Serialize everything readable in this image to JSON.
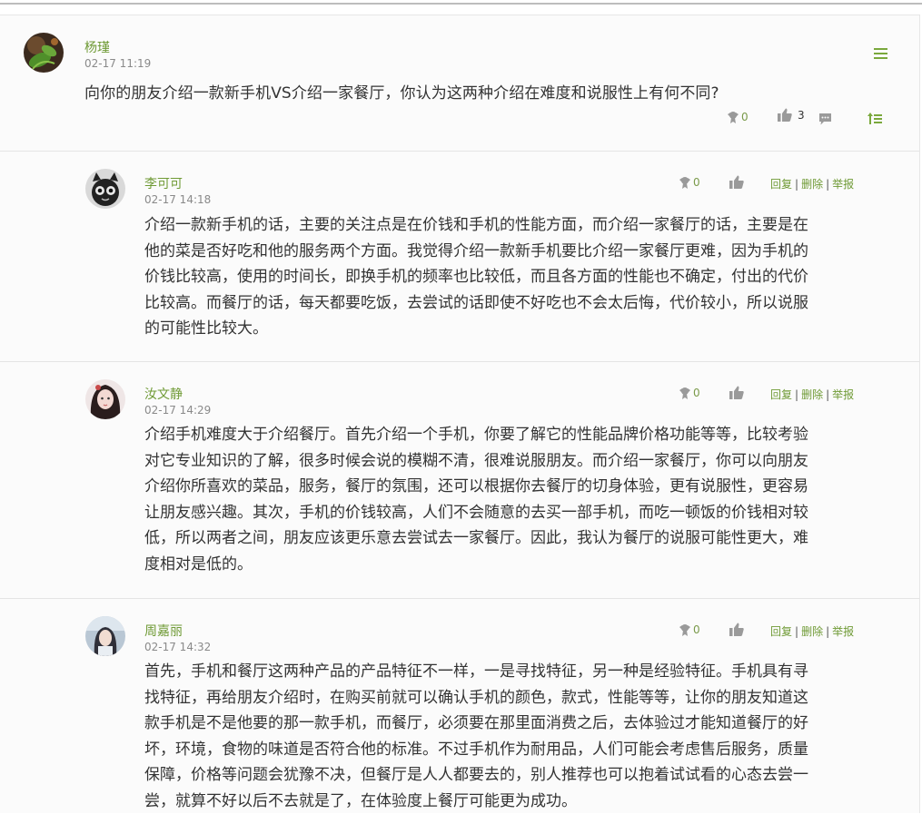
{
  "colors": {
    "accent": "#6f9a35",
    "icon": "#9a9a9a",
    "text": "#333333",
    "muted": "#8a8a8a"
  },
  "post": {
    "author": "杨瑾",
    "time": "02-17 11:19",
    "question": "向你的朋友介绍一款新手机VS介绍一家餐厅，你认为这两种介绍在难度和说服性上有何不同?",
    "badge_count": "0",
    "like_count": "3",
    "menu_icon": "menu-icon",
    "comment_icon": "comment-icon",
    "top_icon": "sort-up-icon"
  },
  "comment_actions": {
    "reply": "回复",
    "delete": "删除",
    "report": "举报",
    "separator": "|"
  },
  "comments": [
    {
      "author": "李可可",
      "time": "02-17 14:18",
      "badge_count": "0",
      "lines": [
        "介绍一款新手机的话，主要的关注点是在价钱和手机的性能方面，而介绍一家餐厅的话，主要是在",
        "他的菜是否好吃和他的服务两个方面。我觉得介绍一款新手机要比介绍一家餐厅更难，因为手机的",
        "价钱比较高，使用的时间长，即换手机的频率也比较低，而且各方面的性能也不确定，付出的代价",
        "比较高。而餐厅的话，每天都要吃饭，去尝试的话即使不好吃也不会太后悔，代价较小，所以说服",
        "的可能性比较大。"
      ]
    },
    {
      "author": "汝文静",
      "time": "02-17 14:29",
      "badge_count": "0",
      "lines": [
        "介绍手机难度大于介绍餐厅。首先介绍一个手机，你要了解它的性能品牌价格功能等等，比较考验",
        "对它专业知识的了解，很多时候会说的模糊不清，很难说服朋友。而介绍一家餐厅，你可以向朋友",
        "介绍你所喜欢的菜品，服务，餐厅的氛围，还可以根据你去餐厅的切身体验，更有说服性，更容易",
        "让朋友感兴趣。其次，手机的价钱较高，人们不会随意的去买一部手机，而吃一顿饭的价钱相对较",
        "低，所以两者之间，朋友应该更乐意去尝试去一家餐厅。因此，我认为餐厅的说服可能性更大，难",
        "度相对是低的。"
      ]
    },
    {
      "author": "周嘉丽",
      "time": "02-17 14:32",
      "badge_count": "0",
      "lines": [
        "首先，手机和餐厅这两种产品的产品特征不一样，一是寻找特征，另一种是经验特征。手机具有寻",
        "找特征，再给朋友介绍时，在购买前就可以确认手机的颜色，款式，性能等等，让你的朋友知道这",
        "款手机是不是他要的那一款手机，而餐厅，必须要在那里面消费之后，去体验过才能知道餐厅的好",
        "坏，环境，食物的味道是否符合他的标准。不过手机作为耐用品，人们可能会考虑售后服务，质量",
        "保障，价格等问题会犹豫不决，但餐厅是人人都要去的，别人推荐也可以抱着试试看的心态去尝一",
        "尝，就算不好以后不去就是了，在体验度上餐厅可能更为成功。"
      ]
    }
  ]
}
